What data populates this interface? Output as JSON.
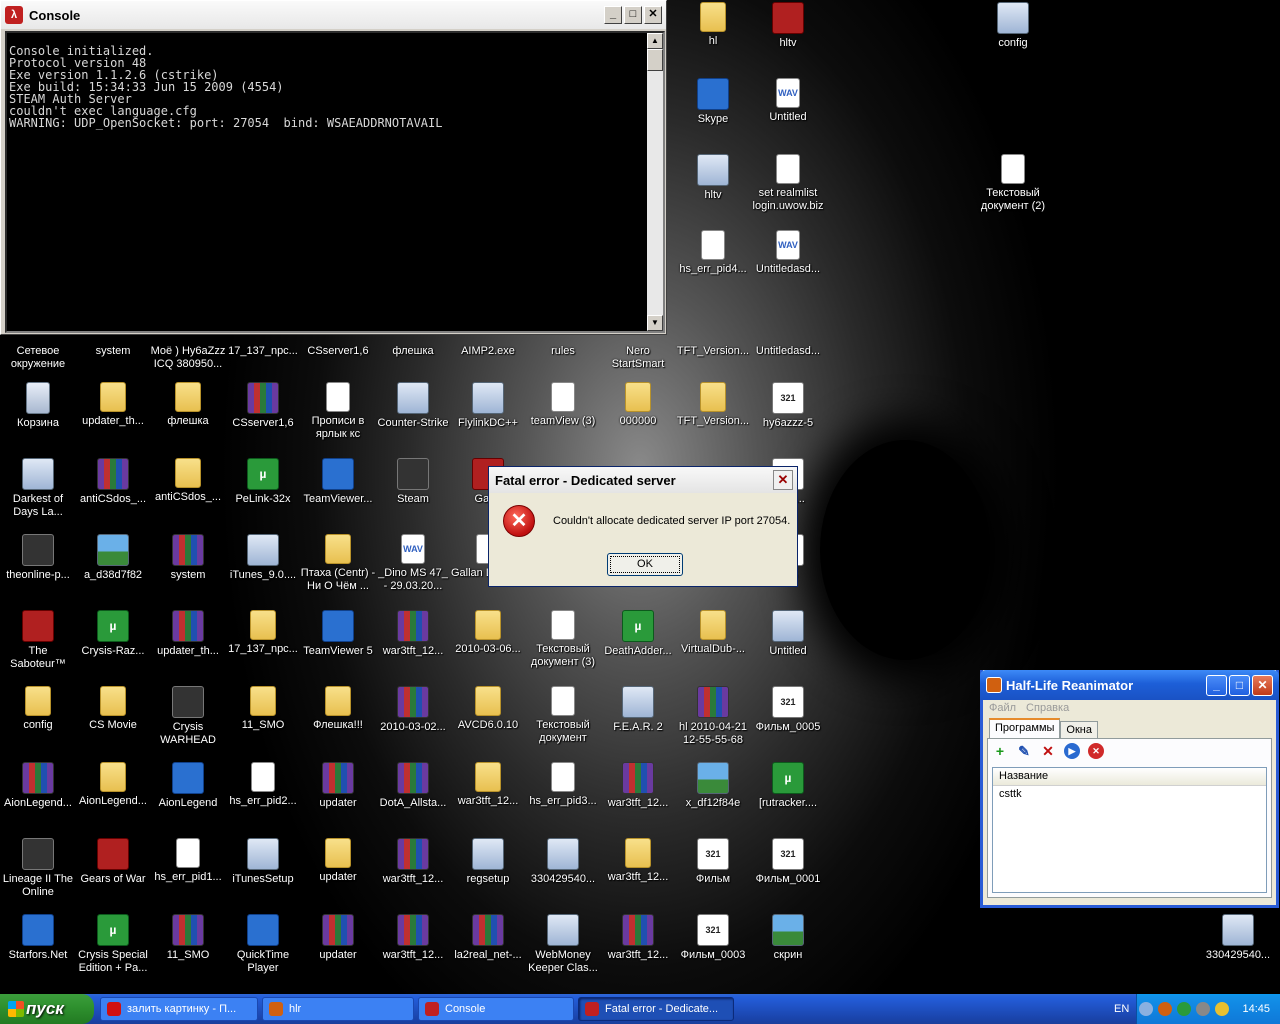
{
  "console": {
    "title": "Console",
    "lines": [
      "Console initialized.",
      "Protocol version 48",
      "Exe version 1.1.2.6 (cstrike)",
      "Exe build: 15:34:33 Jun 15 2009 (4554)",
      "STEAM Auth Server",
      "couldn't exec language.cfg",
      "WARNING: UDP_OpenSocket: port: 27054  bind: WSAEADDRNOTAVAIL"
    ]
  },
  "dialog": {
    "title": "Fatal error - Dedicated server",
    "message": "Couldn't allocate dedicated server IP port 27054.",
    "ok": "OK"
  },
  "hlr": {
    "title": "Half-Life Reanimator",
    "menu": [
      "Файл",
      "Справка"
    ],
    "tabs": [
      "Программы",
      "Окна"
    ],
    "column": "Название",
    "rows": [
      "csttk"
    ]
  },
  "taskbar": {
    "start": "пуск",
    "tasks": [
      "залить картинку - П...",
      "hlr",
      "Console",
      "Fatal error - Dedicate..."
    ],
    "lang": "EN",
    "clock": "14:45"
  },
  "desktop_icons": [
    {
      "label": "Сетевое окружение",
      "kind": "app"
    },
    {
      "label": "system",
      "kind": "folder"
    },
    {
      "label": "Моё ) Ну6аZzz ICQ 380950...",
      "kind": "app"
    },
    {
      "label": "17_137_npc...",
      "kind": "folder"
    },
    {
      "label": "CSserver1,6",
      "kind": "folder"
    },
    {
      "label": "флешка",
      "kind": "folder"
    },
    {
      "label": "AIMP2.exe",
      "kind": "app"
    },
    {
      "label": "rules",
      "kind": "doc"
    },
    {
      "label": "Nero StartSmart",
      "kind": "app"
    },
    {
      "label": "TFT_Version...",
      "kind": "rar"
    },
    {
      "label": "Untitledasd...",
      "kind": "app"
    },
    {
      "label": "Корзина",
      "kind": "bin"
    },
    {
      "label": "updater_th...",
      "kind": "folder"
    },
    {
      "label": "флешка",
      "kind": "folder"
    },
    {
      "label": "CSserver1,6",
      "kind": "rar"
    },
    {
      "label": "Прописи в ярлык кс",
      "kind": "doc"
    },
    {
      "label": "Counter-Strike",
      "kind": "app"
    },
    {
      "label": "FlylinkDC++",
      "kind": "app"
    },
    {
      "label": "teamView (3)",
      "kind": "doc"
    },
    {
      "label": "000000",
      "kind": "folder"
    },
    {
      "label": "TFT_Version...",
      "kind": "folder"
    },
    {
      "label": "hy6azzz-5",
      "kind": "media"
    },
    {
      "label": "Darkest of Days La...",
      "kind": "app"
    },
    {
      "label": "antiCSdos_...",
      "kind": "rar"
    },
    {
      "label": "antiCSdos_...",
      "kind": "folder"
    },
    {
      "label": "PeLink-32x",
      "kind": "green"
    },
    {
      "label": "TeamViewer...",
      "kind": "blue"
    },
    {
      "label": "Steam",
      "kind": "dark"
    },
    {
      "label": "Gar...",
      "kind": "red"
    },
    {
      "label": "...5.a...",
      "kind": "media"
    },
    {
      "label": "theonline-p...",
      "kind": "dark"
    },
    {
      "label": "a_d38d7f82",
      "kind": "img"
    },
    {
      "label": "system",
      "kind": "rar"
    },
    {
      "label": "iTunes_9.0....",
      "kind": "app"
    },
    {
      "label": "Птаха (Centr) - Ни О Чём ...",
      "kind": "folder"
    },
    {
      "label": "_Dino MS 47_ - 29.03.20...",
      "kind": "wav"
    },
    {
      "label": "Gallan Levon...",
      "kind": "doc"
    },
    {
      "label": "...-5",
      "kind": "media"
    },
    {
      "label": "The Saboteur™",
      "kind": "red"
    },
    {
      "label": "Crysis-Raz...",
      "kind": "green"
    },
    {
      "label": "updater_th...",
      "kind": "rar"
    },
    {
      "label": "17_137_npc...",
      "kind": "folder"
    },
    {
      "label": "TeamViewer 5",
      "kind": "blue"
    },
    {
      "label": "war3tft_12...",
      "kind": "rar"
    },
    {
      "label": "2010-03-06...",
      "kind": "folder"
    },
    {
      "label": "Текстовый документ (3)",
      "kind": "doc"
    },
    {
      "label": "DeathAdder...",
      "kind": "green"
    },
    {
      "label": "VirtualDub-...",
      "kind": "folder"
    },
    {
      "label": "Untitled",
      "kind": "app"
    },
    {
      "label": "config",
      "kind": "folder"
    },
    {
      "label": "CS Movie",
      "kind": "folder"
    },
    {
      "label": "Crysis WARHEAD",
      "kind": "dark"
    },
    {
      "label": "11_SMO",
      "kind": "folder"
    },
    {
      "label": "Флешка!!!",
      "kind": "folder"
    },
    {
      "label": "2010-03-02...",
      "kind": "rar"
    },
    {
      "label": "AVCD6.0.10",
      "kind": "folder"
    },
    {
      "label": "Текстовый документ",
      "kind": "doc"
    },
    {
      "label": "F.E.A.R. 2",
      "kind": "app"
    },
    {
      "label": "hl 2010-04-21 12-55-55-68",
      "kind": "rar"
    },
    {
      "label": "Фильм_0005",
      "kind": "media"
    },
    {
      "label": "AionLegend...",
      "kind": "rar"
    },
    {
      "label": "AionLegend...",
      "kind": "folder"
    },
    {
      "label": "AionLegend",
      "kind": "blue"
    },
    {
      "label": "hs_err_pid2...",
      "kind": "doc"
    },
    {
      "label": "updater",
      "kind": "rar"
    },
    {
      "label": "DotA_Allsta...",
      "kind": "rar"
    },
    {
      "label": "war3tft_12...",
      "kind": "folder"
    },
    {
      "label": "hs_err_pid3...",
      "kind": "doc"
    },
    {
      "label": "war3tft_12...",
      "kind": "rar"
    },
    {
      "label": "x_df12f84e",
      "kind": "img"
    },
    {
      "label": "[rutracker....",
      "kind": "green"
    },
    {
      "label": "Lineage II The Online",
      "kind": "dark"
    },
    {
      "label": "Gears of War",
      "kind": "red"
    },
    {
      "label": "hs_err_pid1...",
      "kind": "doc"
    },
    {
      "label": "iTunesSetup",
      "kind": "app"
    },
    {
      "label": "updater",
      "kind": "folder"
    },
    {
      "label": "war3tft_12...",
      "kind": "rar"
    },
    {
      "label": "regsetup",
      "kind": "app"
    },
    {
      "label": "330429540...",
      "kind": "app"
    },
    {
      "label": "war3tft_12...",
      "kind": "folder"
    },
    {
      "label": "Фильм",
      "kind": "media"
    },
    {
      "label": "Фильм_0001",
      "kind": "media"
    },
    {
      "label": "Starfors.Net",
      "kind": "blue"
    },
    {
      "label": "Crysis Special Edition + Pa...",
      "kind": "green"
    },
    {
      "label": "11_SMO",
      "kind": "rar"
    },
    {
      "label": "QuickTime Player",
      "kind": "blue"
    },
    {
      "label": "updater",
      "kind": "rar"
    },
    {
      "label": "war3tft_12...",
      "kind": "rar"
    },
    {
      "label": "la2real_net-...",
      "kind": "rar"
    },
    {
      "label": "WebMoney Keeper Clas...",
      "kind": "app"
    },
    {
      "label": "war3tft_12...",
      "kind": "rar"
    },
    {
      "label": "Фильм_0003",
      "kind": "media"
    },
    {
      "label": "скрин",
      "kind": "img"
    },
    {
      "label": "hl",
      "kind": "folder"
    },
    {
      "label": "hltv",
      "kind": "red"
    },
    {
      "label": "config",
      "kind": "app"
    },
    {
      "label": "Skype",
      "kind": "blue"
    },
    {
      "label": "Untitled",
      "kind": "wav"
    },
    {
      "label": "hltv",
      "kind": "app"
    },
    {
      "label": "set realmlist login.uwow.biz",
      "kind": "doc"
    },
    {
      "label": "Текстовый документ (2)",
      "kind": "doc"
    },
    {
      "label": "hs_err_pid4...",
      "kind": "doc"
    },
    {
      "label": "Untitledasd...",
      "kind": "wav"
    },
    {
      "label": "330429540...",
      "kind": "app"
    }
  ]
}
